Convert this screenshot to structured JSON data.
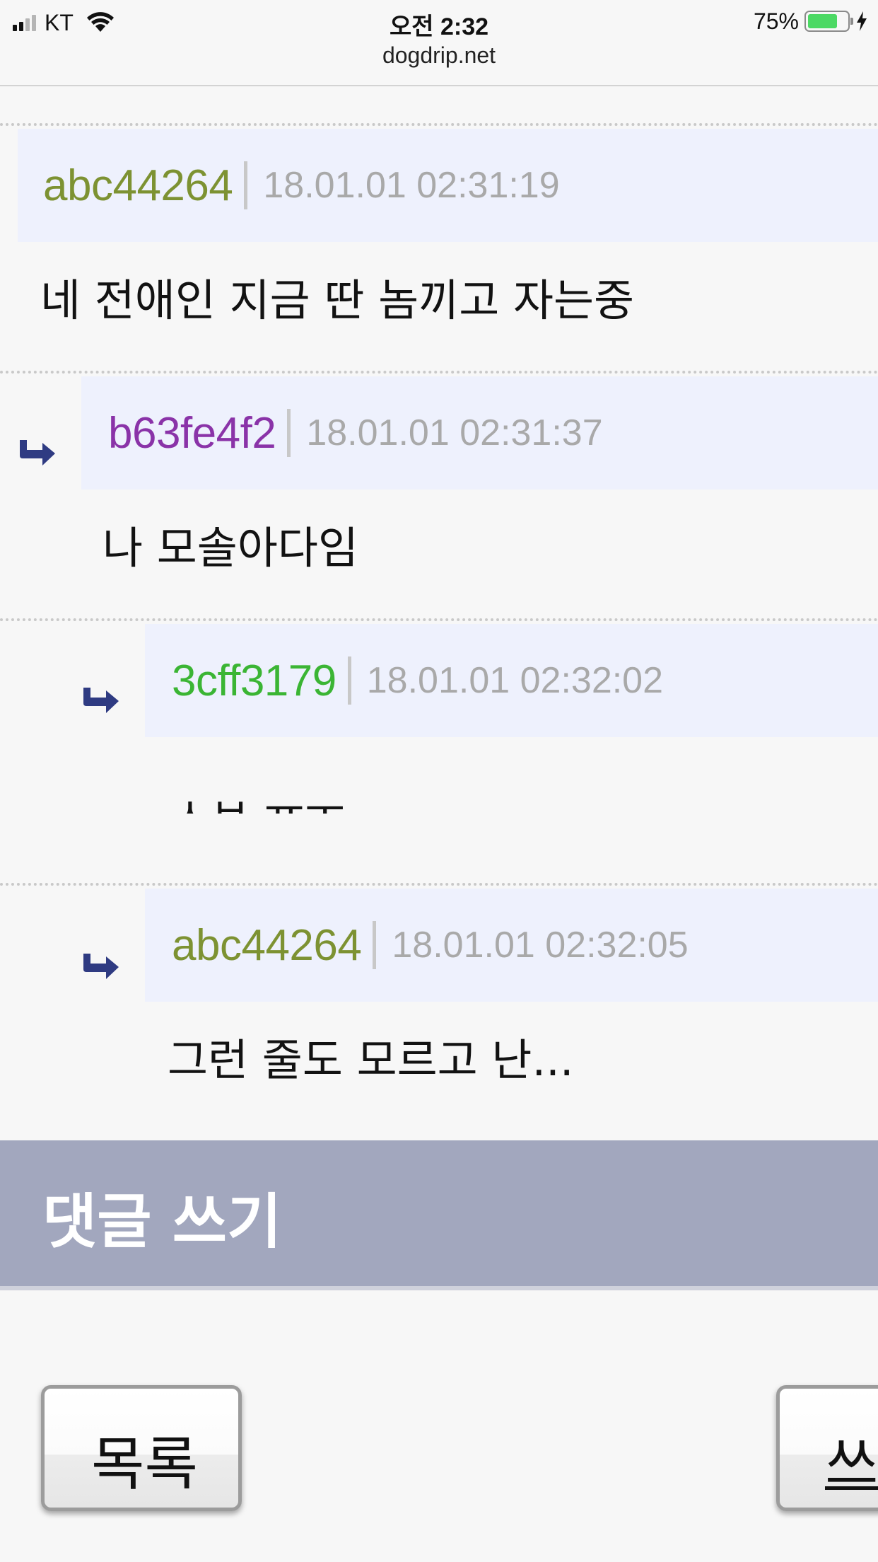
{
  "status_bar": {
    "carrier": "KT",
    "time": "오전 2:32",
    "url": "dogdrip.net",
    "battery_percent": "75%",
    "battery_level": 0.75,
    "battery_color": "#4cd964",
    "signal_bars": 4,
    "signal_bars_filled": 2,
    "charging": true
  },
  "comments": [
    {
      "author": "abc44264",
      "author_color": "#7d9232",
      "date": "18.01.01 02:31:19",
      "text": "네 전애인 지금 딴 놈끼고 자는중",
      "depth": 0
    },
    {
      "author": "b63fe4f2",
      "author_color": "#8a33a8",
      "date": "18.01.01 02:31:37",
      "text": "나 모솔아다임",
      "depth": 1
    },
    {
      "author": "3cff3179",
      "author_color": "#3bb534",
      "date": "18.01.01 02:32:02",
      "text": "ㅅㅂ ㅠㅜ",
      "depth": 2
    },
    {
      "author": "abc44264",
      "author_color": "#7d9232",
      "date": "18.01.01 02:32:05",
      "text": "그런 줄도 모르고 난...",
      "depth": 2
    }
  ],
  "write_comment": {
    "label": "댓글 쓰기"
  },
  "buttons": {
    "list_label": "목록",
    "write_label": "쓰"
  },
  "icons": {
    "reply": "reply-arrow-icon",
    "wifi": "wifi-icon",
    "battery": "battery-icon",
    "charging": "bolt-icon",
    "signal": "signal-icon"
  }
}
